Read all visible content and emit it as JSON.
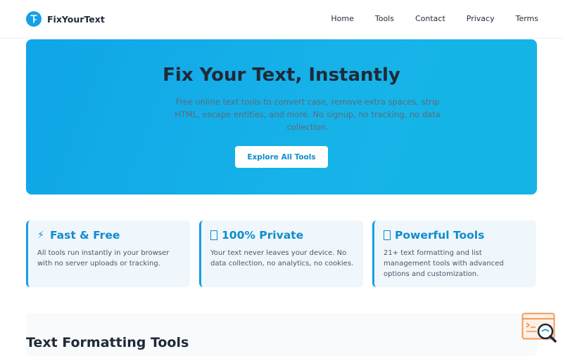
{
  "header": {
    "brand": "FixYourText",
    "nav": [
      "Home",
      "Tools",
      "Contact",
      "Privacy",
      "Terms"
    ]
  },
  "hero": {
    "title": "Fix Your Text, Instantly",
    "subtitle": "Free online text tools to convert case, remove extra spaces, strip HTML, escape entities, and more. No signup, no tracking, no data collection.",
    "cta": "Explore All Tools"
  },
  "features": [
    {
      "icon": "lightning-icon",
      "title": "Fast & Free",
      "desc": "All tools run instantly in your browser with no server uploads or tracking."
    },
    {
      "icon": "lock-icon",
      "title": "100% Private",
      "desc": "Your text never leaves your device. No data collection, no analytics, no cookies."
    },
    {
      "icon": "wrench-icon",
      "title": "Powerful Tools",
      "desc": "21+ text formatting and list management tools with advanced options and customization."
    }
  ],
  "section": {
    "title": "Text Formatting Tools"
  },
  "colors": {
    "accent": "#16a0e6",
    "hero_gradient_start": "#10a5e8",
    "feature_bg": "#f0f7fc",
    "widget_orange": "#f29b5a"
  }
}
